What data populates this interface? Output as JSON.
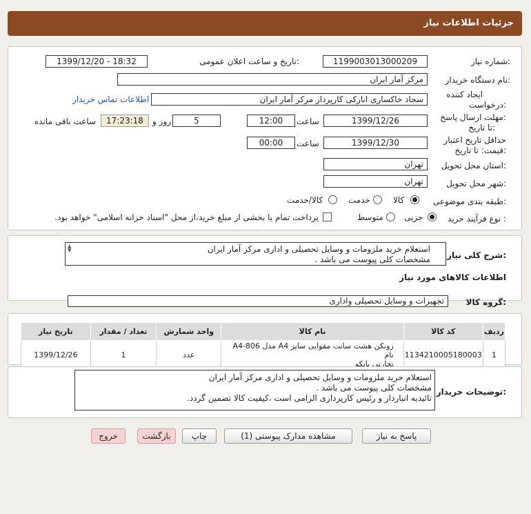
{
  "header": {
    "title": "جزئیات اطلاعات نیاز"
  },
  "form": {
    "need_number_label": "شماره نیاز:",
    "need_number": "1199003013000209",
    "announce_datetime_label": "تاریخ و ساعت اعلان عمومی:",
    "announce_datetime": "1399/12/20 - 18:32",
    "buyer_org_label": "نام دستگاه خریدار:",
    "buyer_org": "مرکز آمار ایران",
    "requester_label_1": "ایجاد کننده",
    "requester_label_2": "درخواست:",
    "requester": "سجاد خاکساری اناركی کارپرداز مرکز آمار ایران",
    "contact_link": "اطلاعات تماس خریدار",
    "reply_deadline_label_1": "مهلت ارسال پاسخ:",
    "reply_deadline_label_2": "تا تاریخ:",
    "reply_date": "1399/12/26",
    "time_label": "ساعت",
    "reply_time": "12:00",
    "days_value": "5",
    "days_label": "روز و",
    "remaining_time": "17:23:18",
    "remaining_label": "ساعت باقی مانده",
    "price_validity_label_1": "حداقل تاریخ اعتبار",
    "price_validity_label_2": "قیمت: تا تاریخ:",
    "validity_date": "1399/12/30",
    "validity_time_label": "ساعت",
    "validity_time": "00:00",
    "province_label": "استان محل تحویل:",
    "province": "تهران",
    "city_label": "شهر محل تحویل:",
    "city": "تهران",
    "category_label": "طبقه بندی موضوعی:",
    "category_options": [
      "کالا",
      "خدمت",
      "کالا/خدمت"
    ],
    "process_label": "نوع فرآیند خرید :",
    "process_options": [
      "جزیی",
      "متوسط"
    ],
    "payment_note": "پرداخت تمام یا بخشی از مبلغ خرید،از محل \"اسناد خزانه اسلامی\" خواهد بود."
  },
  "description": {
    "label": "شرح کلی نیاز:",
    "line1": "استعلام خرید ملزومات و وسایل تحصیلی و اداری مرکز آمار ایران",
    "line2": "مشخصات کلی پیوست می باشد ."
  },
  "goods": {
    "section_title": "اطلاعات کالاهای مورد نیاز",
    "group_label": "گروه کالا:",
    "group_value": "تجهیزات و وسایل تحصیلی واداری",
    "columns": [
      "ردیف",
      "کد کالا",
      "نام کالا",
      "واحد شمارش",
      "تعداد / مقدار",
      "تاریخ نیاز"
    ],
    "rows": [
      {
        "index": "1",
        "code": "1134210005180003",
        "name_line1": "زونکن هشت سانت مقوایی سایز A4 مدل A4-806 نام",
        "name_line2": "تجارتی پاپکو",
        "unit": "عدد",
        "qty": "1",
        "date": "1399/12/26"
      }
    ]
  },
  "buyer_notes": {
    "label": "توضیحات خریدار:",
    "line1": "استعلام خرید ملزومات و وسایل تحصیلی و اداری مرکز آمار ایران",
    "line2": "مشخصات کلی پیوست می باشد .",
    "line3": "تائیدیه انباردار و رئیس کارپردازی الزامی است ،کیفیت کالا تضمین گردد."
  },
  "buttons": {
    "reply": "پاسخ به نیاز",
    "view_attachments": "مشاهده مدارک پیوستی (1)",
    "print": "چاپ",
    "back": "بازگشت",
    "exit": "خروج"
  }
}
